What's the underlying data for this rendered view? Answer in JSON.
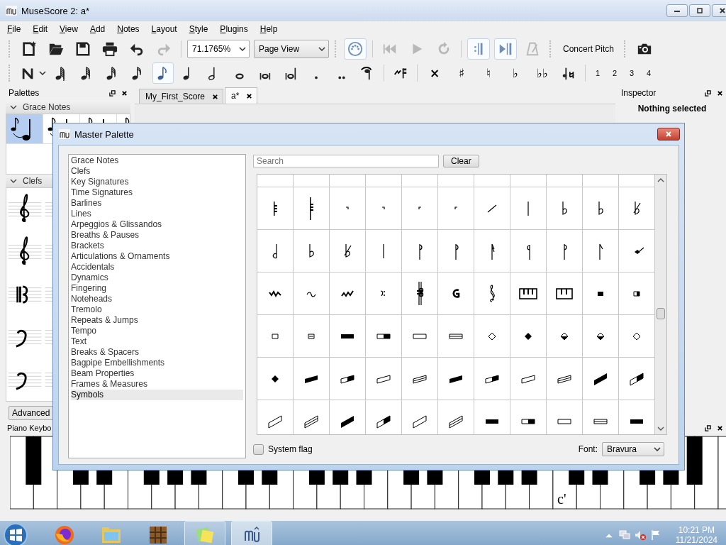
{
  "window": {
    "title": "MuseScore 2: a*"
  },
  "menu": [
    "File",
    "Edit",
    "View",
    "Add",
    "Notes",
    "Layout",
    "Style",
    "Plugins",
    "Help"
  ],
  "toolbar": {
    "file_buttons": [
      {
        "kind": "new",
        "disabled": false
      },
      {
        "kind": "open",
        "disabled": false
      },
      {
        "kind": "save",
        "disabled": false
      },
      {
        "kind": "print",
        "disabled": false
      },
      {
        "kind": "undo",
        "disabled": false
      },
      {
        "kind": "redo",
        "disabled": true
      }
    ],
    "zoom": "71.1765%",
    "view_mode": "Page View",
    "playback": [
      {
        "kind": "midi",
        "on": true,
        "disabled": false
      },
      {
        "kind": "rewind",
        "on": false,
        "disabled": true
      },
      {
        "kind": "play",
        "on": false,
        "disabled": true
      },
      {
        "kind": "loop",
        "on": false,
        "disabled": true
      },
      {
        "kind": "repeat",
        "on": true,
        "disabled": false
      },
      {
        "kind": "pan",
        "on": true,
        "disabled": false
      },
      {
        "kind": "metronome",
        "on": false,
        "disabled": true
      }
    ],
    "concert_pitch": {
      "label": "Concert Pitch",
      "on": false
    }
  },
  "note_input": {
    "durations": [
      {
        "selected": false
      },
      {
        "selected": false
      },
      {
        "selected": false
      },
      {
        "selected": false
      },
      {
        "selected": true
      },
      {
        "selected": false
      },
      {
        "selected": false
      },
      {
        "selected": false
      },
      {
        "selected": false
      },
      {
        "selected": false
      }
    ],
    "accidentals": [
      "×",
      "♯",
      "♮",
      "♭",
      "♭♭"
    ],
    "voices": [
      "1",
      "2",
      "3",
      "4"
    ]
  },
  "palettes": {
    "title": "Palettes",
    "sections": [
      {
        "label": "Grace Notes",
        "expanded": true
      },
      {
        "label": "Clefs",
        "expanded": true
      }
    ],
    "grace_cells": [
      {
        "selected": true
      },
      {
        "selected": false
      },
      {
        "selected": false
      },
      {
        "selected": false
      }
    ],
    "advanced": "Advanced"
  },
  "tabs": [
    {
      "label": "My_First_Score",
      "selected": false
    },
    {
      "label": "a*",
      "selected": true
    }
  ],
  "inspector": {
    "title": "Inspector",
    "status": "Nothing selected"
  },
  "piano": {
    "title": "Piano Keybo",
    "label": "c'"
  },
  "master_palette": {
    "title": "Master Palette",
    "categories": [
      {
        "label": "Grace Notes",
        "selected": false
      },
      {
        "label": "Clefs",
        "selected": false
      },
      {
        "label": "Key Signatures",
        "selected": false
      },
      {
        "label": "Time Signatures",
        "selected": false
      },
      {
        "label": "Barlines",
        "selected": false
      },
      {
        "label": "Lines",
        "selected": false
      },
      {
        "label": "Arpeggios & Glissandos",
        "selected": false
      },
      {
        "label": "Breaths & Pauses",
        "selected": false
      },
      {
        "label": "Brackets",
        "selected": false
      },
      {
        "label": "Articulations & Ornaments",
        "selected": false
      },
      {
        "label": "Accidentals",
        "selected": false
      },
      {
        "label": "Dynamics",
        "selected": false
      },
      {
        "label": "Fingering",
        "selected": false
      },
      {
        "label": "Noteheads",
        "selected": false
      },
      {
        "label": "Tremolo",
        "selected": false
      },
      {
        "label": "Repeats & Jumps",
        "selected": false
      },
      {
        "label": "Tempo",
        "selected": false
      },
      {
        "label": "Text",
        "selected": false
      },
      {
        "label": "Breaks & Spacers",
        "selected": false
      },
      {
        "label": "Bagpipe Embellishments",
        "selected": false
      },
      {
        "label": "Beam Properties",
        "selected": false
      },
      {
        "label": "Frames & Measures",
        "selected": false
      },
      {
        "label": "Symbols",
        "selected": true
      }
    ],
    "search": {
      "placeholder": "Search"
    },
    "clear": "Clear",
    "system_flag": {
      "label": "System flag",
      "checked": false
    },
    "font_label": "Font:",
    "font": "Bravura"
  },
  "taskbar": {
    "apps": [
      {
        "kind": "browser",
        "running": false,
        "selected": false
      },
      {
        "kind": "files",
        "running": false,
        "selected": false
      },
      {
        "kind": "blocks",
        "running": false,
        "selected": false
      },
      {
        "kind": "notes",
        "running": true,
        "selected": false
      },
      {
        "kind": "musescore",
        "running": true,
        "selected": true
      }
    ],
    "time": "10:21 PM",
    "date": "11/21/2024"
  }
}
